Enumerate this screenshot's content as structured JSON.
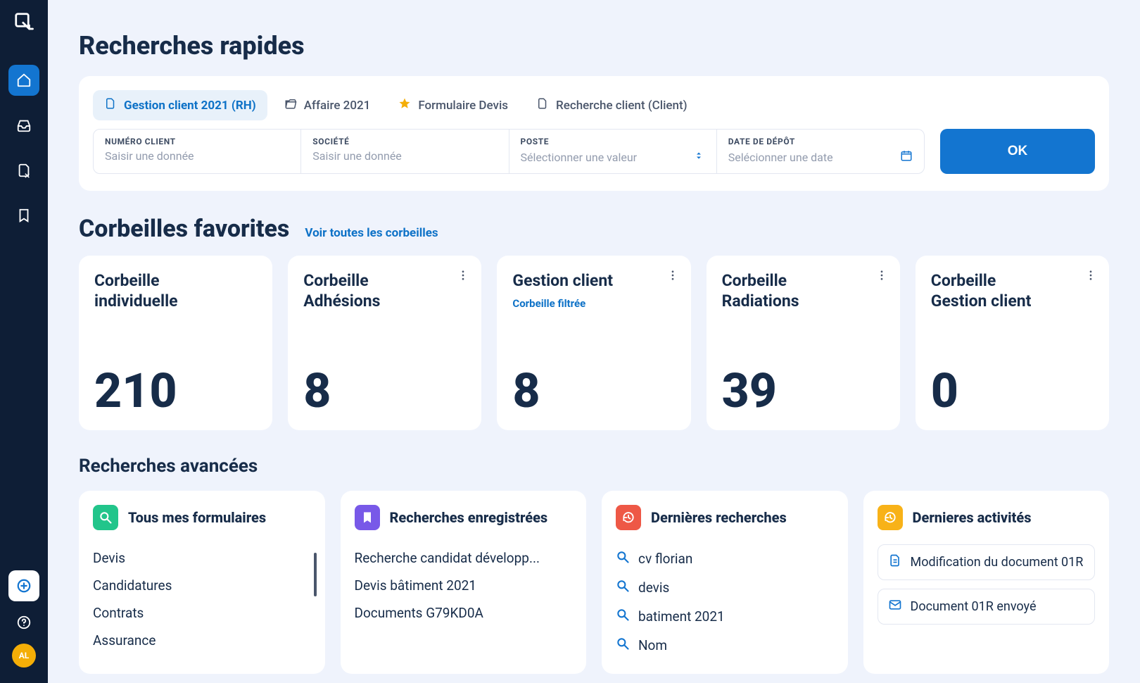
{
  "sidebar": {
    "avatar_initials": "AL"
  },
  "quick_search": {
    "title": "Recherches rapides",
    "tabs": [
      {
        "label": "Gestion client 2021 (RH)",
        "icon": "file",
        "active": true
      },
      {
        "label": "Affaire 2021",
        "icon": "folder-open",
        "active": false
      },
      {
        "label": "Formulaire Devis",
        "icon": "star",
        "active": false
      },
      {
        "label": "Recherche client (Client)",
        "icon": "file",
        "active": false
      }
    ],
    "fields": {
      "client_no": {
        "label": "NUMÉRO CLIENT",
        "placeholder": "Saisir une donnée"
      },
      "company": {
        "label": "SOCIÉTÉ",
        "placeholder": "Saisir une donnée"
      },
      "position": {
        "label": "POSTE",
        "placeholder": "Sélectionner une valeur"
      },
      "date": {
        "label": "DATE DE DÉPÔT",
        "placeholder": "Selécionner une date"
      }
    },
    "ok_label": "OK"
  },
  "fav_section": {
    "title": "Corbeilles favorites",
    "link": "Voir toutes les corbeilles",
    "cards": [
      {
        "title": "Corbeille individuelle",
        "subtitle": "",
        "count": "210",
        "menu": false
      },
      {
        "title": "Corbeille Adhésions",
        "subtitle": "",
        "count": "8",
        "menu": true
      },
      {
        "title": "Gestion client",
        "subtitle": "Corbeille filtrée",
        "count": "8",
        "menu": true
      },
      {
        "title": "Corbeille Radiations",
        "subtitle": "",
        "count": "39",
        "menu": true
      },
      {
        "title": "Corbeille Gestion client",
        "subtitle": "",
        "count": "0",
        "menu": true
      }
    ]
  },
  "advanced": {
    "title": "Recherches avancées",
    "forms": {
      "title": "Tous mes formulaires",
      "items": [
        "Devis",
        "Candidatures",
        "Contrats",
        "Assurance"
      ]
    },
    "saved": {
      "title": "Recherches enregistrées",
      "items": [
        "Recherche candidat développ...",
        "Devis bâtiment 2021",
        "Documents G79KD0A"
      ]
    },
    "recent": {
      "title": "Dernières recherches",
      "items": [
        "cv florian",
        "devis",
        "batiment 2021",
        "Nom"
      ]
    },
    "activity": {
      "title": "Dernieres activités",
      "items": [
        {
          "label": "Modification du document 01R",
          "icon": "doc"
        },
        {
          "label": "Document 01R envoyé",
          "icon": "mail"
        }
      ]
    }
  }
}
